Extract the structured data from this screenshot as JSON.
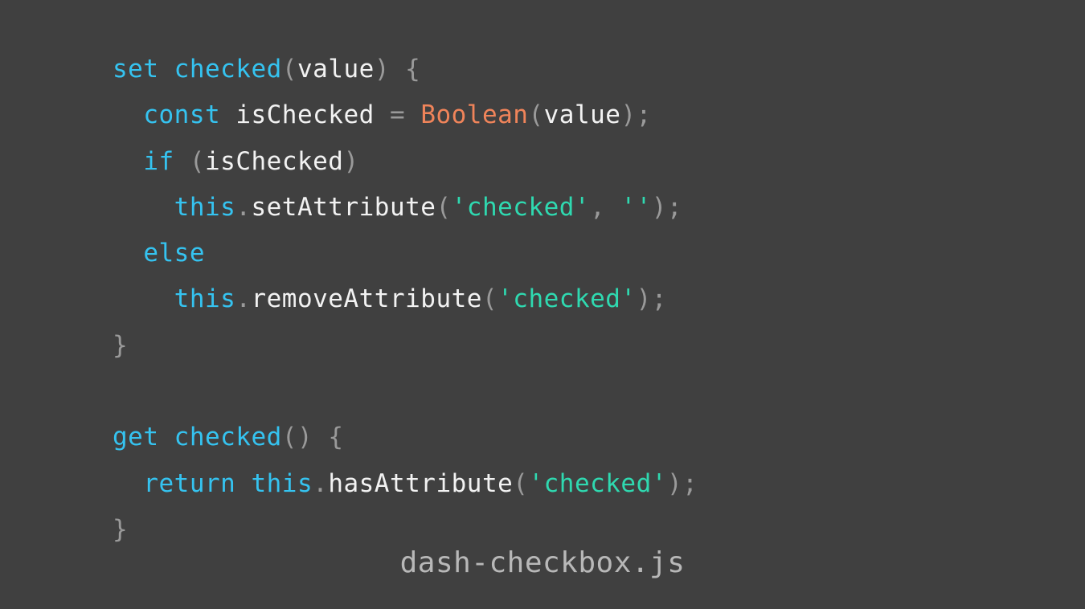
{
  "colors": {
    "background": "#404040",
    "keyword": "#35c3f0",
    "identifier": "#f2f2f2",
    "punctuation": "#9a9a9a",
    "string": "#2fd9b0",
    "type": "#f0845a",
    "caption": "#b8b8b8"
  },
  "code_lines": [
    [
      {
        "t": "set",
        "k": "kw"
      },
      {
        "t": " ",
        "k": "id"
      },
      {
        "t": "checked",
        "k": "fn"
      },
      {
        "t": "(",
        "k": "punc"
      },
      {
        "t": "value",
        "k": "id"
      },
      {
        "t": ")",
        "k": "punc"
      },
      {
        "t": " ",
        "k": "id"
      },
      {
        "t": "{",
        "k": "punc"
      }
    ],
    [
      {
        "t": "  ",
        "k": "id"
      },
      {
        "t": "const",
        "k": "kw"
      },
      {
        "t": " isChecked ",
        "k": "id"
      },
      {
        "t": "=",
        "k": "punc"
      },
      {
        "t": " ",
        "k": "id"
      },
      {
        "t": "Boolean",
        "k": "type"
      },
      {
        "t": "(",
        "k": "punc"
      },
      {
        "t": "value",
        "k": "id"
      },
      {
        "t": ");",
        "k": "punc"
      }
    ],
    [
      {
        "t": "  ",
        "k": "id"
      },
      {
        "t": "if",
        "k": "kw"
      },
      {
        "t": " ",
        "k": "id"
      },
      {
        "t": "(",
        "k": "punc"
      },
      {
        "t": "isChecked",
        "k": "id"
      },
      {
        "t": ")",
        "k": "punc"
      }
    ],
    [
      {
        "t": "    ",
        "k": "id"
      },
      {
        "t": "this",
        "k": "kw"
      },
      {
        "t": ".",
        "k": "punc"
      },
      {
        "t": "setAttribute",
        "k": "id"
      },
      {
        "t": "(",
        "k": "punc"
      },
      {
        "t": "'checked'",
        "k": "str"
      },
      {
        "t": ", ",
        "k": "punc"
      },
      {
        "t": "''",
        "k": "str"
      },
      {
        "t": ");",
        "k": "punc"
      }
    ],
    [
      {
        "t": "  ",
        "k": "id"
      },
      {
        "t": "else",
        "k": "kw"
      }
    ],
    [
      {
        "t": "    ",
        "k": "id"
      },
      {
        "t": "this",
        "k": "kw"
      },
      {
        "t": ".",
        "k": "punc"
      },
      {
        "t": "removeAttribute",
        "k": "id"
      },
      {
        "t": "(",
        "k": "punc"
      },
      {
        "t": "'checked'",
        "k": "str"
      },
      {
        "t": ");",
        "k": "punc"
      }
    ],
    [
      {
        "t": "}",
        "k": "punc"
      }
    ],
    [],
    [
      {
        "t": "get",
        "k": "kw"
      },
      {
        "t": " ",
        "k": "id"
      },
      {
        "t": "checked",
        "k": "fn"
      },
      {
        "t": "()",
        "k": "punc"
      },
      {
        "t": " ",
        "k": "id"
      },
      {
        "t": "{",
        "k": "punc"
      }
    ],
    [
      {
        "t": "  ",
        "k": "id"
      },
      {
        "t": "return",
        "k": "kw"
      },
      {
        "t": " ",
        "k": "id"
      },
      {
        "t": "this",
        "k": "kw"
      },
      {
        "t": ".",
        "k": "punc"
      },
      {
        "t": "hasAttribute",
        "k": "id"
      },
      {
        "t": "(",
        "k": "punc"
      },
      {
        "t": "'checked'",
        "k": "str"
      },
      {
        "t": ");",
        "k": "punc"
      }
    ],
    [
      {
        "t": "}",
        "k": "punc"
      }
    ]
  ],
  "caption": "dash-checkbox.js"
}
